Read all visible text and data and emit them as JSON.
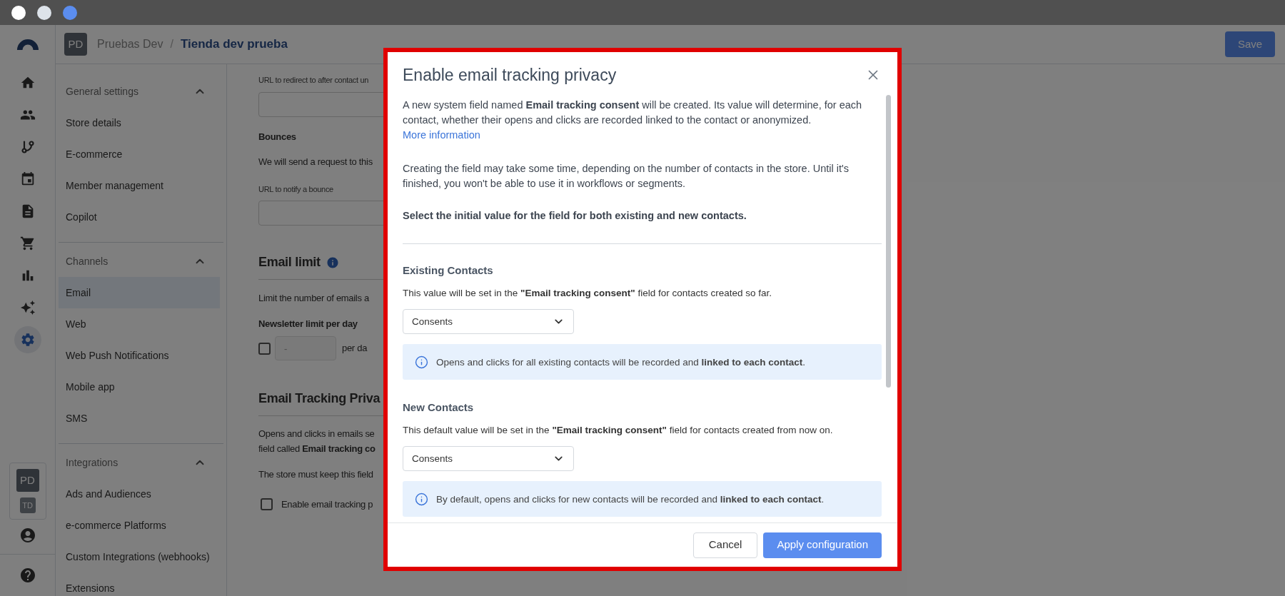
{
  "window_controls": [
    {
      "color": "#ffffff"
    },
    {
      "color": "#dde3ea"
    },
    {
      "color": "#5b8def"
    }
  ],
  "rail": {
    "items": [
      {
        "kind": "home",
        "selected": false
      },
      {
        "kind": "people",
        "selected": false
      },
      {
        "kind": "branch",
        "selected": false
      },
      {
        "kind": "calendar",
        "selected": false
      },
      {
        "kind": "document",
        "selected": false
      },
      {
        "kind": "cart",
        "selected": false
      },
      {
        "kind": "chart",
        "selected": false
      },
      {
        "kind": "sparkles",
        "selected": false
      },
      {
        "kind": "settings",
        "selected": true
      }
    ],
    "accounts": [
      {
        "label": "PD",
        "selected": true
      },
      {
        "label": "TD",
        "selected": false
      }
    ]
  },
  "header": {
    "avatar": "PD",
    "workspace": "Pruebas Dev",
    "separator": "/",
    "store": "Tienda dev prueba",
    "save_button": "Save"
  },
  "settings_nav": {
    "groups": [
      {
        "title": "General settings",
        "expanded": true,
        "items": [
          {
            "label": "Store details",
            "selected": false
          },
          {
            "label": "E-commerce",
            "selected": false
          },
          {
            "label": "Member management",
            "selected": false
          },
          {
            "label": "Copilot",
            "selected": false
          }
        ]
      },
      {
        "title": "Channels",
        "expanded": true,
        "items": [
          {
            "label": "Email",
            "selected": true
          },
          {
            "label": "Web",
            "selected": false
          },
          {
            "label": "Web Push Notifications",
            "selected": false
          },
          {
            "label": "Mobile app",
            "selected": false
          },
          {
            "label": "SMS",
            "selected": false
          }
        ]
      },
      {
        "title": "Integrations",
        "expanded": true,
        "items": [
          {
            "label": "Ads and Audiences",
            "selected": false
          },
          {
            "label": "e-commerce Platforms",
            "selected": false
          },
          {
            "label": "Custom Integrations (webhooks)",
            "selected": false
          },
          {
            "label": "Extensions",
            "selected": false
          }
        ]
      }
    ]
  },
  "content": {
    "redirect_label": "URL to redirect to after contact un",
    "bounces_title": "Bounces",
    "bounces_text": "We will send a request to this",
    "bounce_url_label": "URL to notify a bounce",
    "email_limit": {
      "title": "Email limit",
      "text": "Limit the number of emails a",
      "field_label": "Newsletter limit per day",
      "checked": false,
      "placeholder": "-",
      "unit": "per da"
    },
    "tracking": {
      "title": "Email Tracking Priva",
      "text_lines": [
        "Opens and clicks in emails se",
        "field called **Email tracking co**"
      ],
      "note": "The store must keep this field",
      "checkbox": {
        "label": "Enable email tracking p",
        "checked": false
      }
    }
  },
  "modal": {
    "title": "Enable email tracking privacy",
    "intro": "A new system field named **Email tracking consent** will be created. Its value will determine, for each contact, whether their opens and clicks are recorded linked to the contact or anonymized.",
    "link": "More information",
    "note": "Creating the field may take some time, depending on the number of contacts in the store. Until it's finished, you won't be able to use it in workflows or segments.",
    "prompt": "Select the initial value for the field for both existing and new contacts.",
    "sections": [
      {
        "title": "Existing Contacts",
        "description": "This value will be set in the **\"Email tracking consent\"** field for contacts created so far.",
        "value": "Consents",
        "info": "Opens and clicks for all existing contacts will be recorded and **linked to each contact**."
      },
      {
        "title": "New Contacts",
        "description": "This default value will be set in the **\"Email tracking consent\"** field for contacts created from now on.",
        "value": "Consents",
        "info": "By default, opens and clicks for new contacts will be recorded and **linked to each contact**."
      }
    ],
    "buttons": [
      {
        "label": "Cancel",
        "kind": "secondary"
      },
      {
        "label": "Apply configuration",
        "kind": "primary"
      }
    ]
  }
}
